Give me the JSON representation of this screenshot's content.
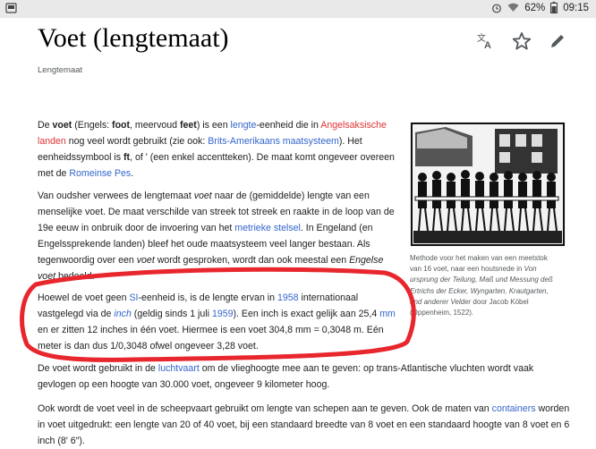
{
  "status": {
    "battery": "62%",
    "time": "09:15"
  },
  "article": {
    "title": "Voet (lengtemaat)",
    "subtitle": "Lengtemaat"
  },
  "actions": {
    "translate_icon": "translate-icon",
    "star_icon": "star-icon",
    "edit_icon": "pencil-icon"
  },
  "p1": {
    "l1a": "De ",
    "l1b": "voet",
    "l1c": " (Engels: ",
    "l1d": "foot",
    "l1e": ", meervoud ",
    "l1f": "feet",
    "l1g": ") is een ",
    "l1h": "lengte",
    "l1i": "-eenheid die in ",
    "l1j": "Angelsaksische",
    "l2a": "landen",
    "l2b": " nog veel wordt gebruikt (zie ook: ",
    "l2c": "Brits-Amerikaans maatsysteem",
    "l2d": "). Het",
    "l3a": "eenheidssymbool is ",
    "l3b": "ft",
    "l3c": ", of ' (een enkel accentteken). De maat komt ongeveer overeen",
    "l4a": "met de ",
    "l4b": "Romeinse Pes",
    "l4c": "."
  },
  "p2": {
    "l1a": "Van oudsher verwees de lengtemaat ",
    "l1b": "voet",
    "l1c": " naar de (gemiddelde) lengte van een",
    "l2": "menselijke voet. De maat verschilde van streek tot streek en raakte in de loop van de",
    "l3a": "19e eeuw in onbruik door de invoering van het ",
    "l3b": "metrieke stelsel",
    "l3c": ". In Engeland (en",
    "l4": "Engelssprekende landen) bleef het oude maatsysteem veel langer bestaan. Als",
    "l5a": "tegenwoordig over een ",
    "l5b": "voet",
    "l5c": " wordt gesproken, wordt dan ook meestal een ",
    "l5d": "Engelse",
    "l6a": "voet",
    "l6b": " bedoeld."
  },
  "p3": {
    "l1a": "Hoewel de voet geen ",
    "l1b": "SI",
    "l1c": "-eenheid is, is de lengte ervan in ",
    "l1d": "1958",
    "l1e": " internationaal",
    "l2a": "vastgelegd via de ",
    "l2b": "inch",
    "l2c": " (geldig sinds 1 juli ",
    "l2d": "1959",
    "l2e": "). Een inch is exact gelijk aan 25,4 ",
    "l2f": "mm",
    "l3": "en er zitten 12 inches in één voet. Hiermee is een voet 304,8 mm = 0,3048 m. Eén",
    "l4": "meter is dan dus 1/0,3048 ofwel ongeveer 3,28 voet."
  },
  "p4": {
    "l1a": "De voet wordt gebruikt in de ",
    "l1b": "luchtvaart",
    "l1c": " om de vlieghoogte mee aan te geven: op trans-Atlantische vluchten wordt vaak",
    "l2": "gevlogen op een hoogte van 30.000 voet, ongeveer 9 kilometer hoog."
  },
  "p5": {
    "l1a": "Ook wordt de voet veel in de scheepvaart gebruikt om lengte van schepen aan te geven. Ook de maten van ",
    "l1b": "containers",
    "l1c": " worden",
    "l2": "in voet uitgedrukt: een lengte van 20 of 40 voet, bij een standaard breedte van 8 voet en een standaard hoogte van 8 voet en 6",
    "l3": "inch (8′ 6″)."
  },
  "figure": {
    "c1": "Methode voor het maken van een meetstok",
    "c2a": "van 16 voet, naar een houtsnede in ",
    "c2b": "Von",
    "c3": "ursprung der Teilung, Maß und Messung deß",
    "c4": "Ertrichs der Ecker, Wyngarten, Krautgarten,",
    "c5a": "und anderer Velder",
    "c5b": " door Jacob Köbel",
    "c6": "(Oppenheim, 1522)."
  },
  "annotation": {
    "color": "#e8262d"
  }
}
